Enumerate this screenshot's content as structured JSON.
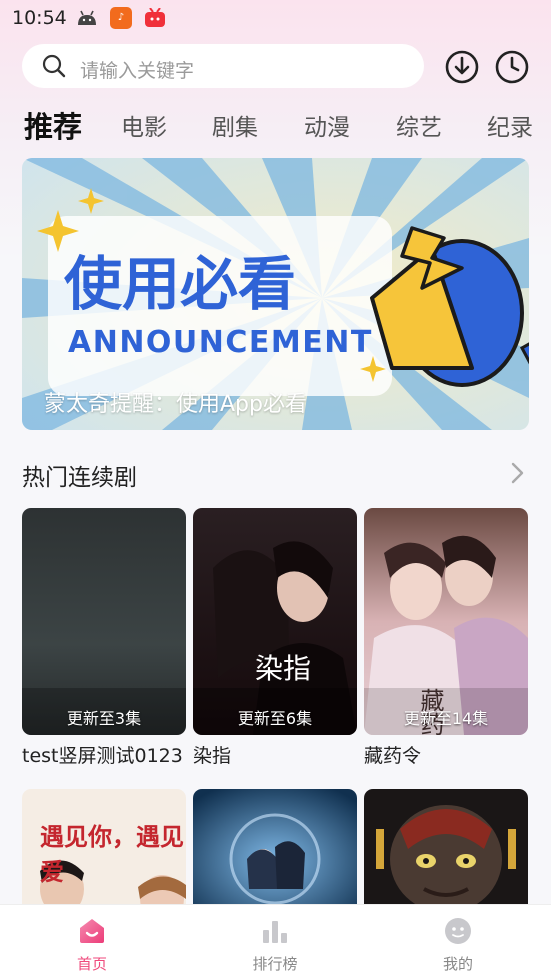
{
  "status_bar": {
    "time": "10:54"
  },
  "search": {
    "placeholder": "请输入关键字"
  },
  "tabs": [
    {
      "label": "推荐",
      "active": true
    },
    {
      "label": "电影"
    },
    {
      "label": "剧集"
    },
    {
      "label": "动漫"
    },
    {
      "label": "综艺"
    },
    {
      "label": "纪录"
    }
  ],
  "banner": {
    "headline": "使用必看",
    "subheadline": "ANNOUNCEMENT",
    "caption": "蒙太奇提醒：使用App必看"
  },
  "section": {
    "title": "热门连续剧"
  },
  "shows": [
    {
      "title": "test竖屏测试0123",
      "badge": "更新至3集"
    },
    {
      "title": "染指",
      "badge": "更新至6集",
      "poster_text": "染指"
    },
    {
      "title": "藏药令",
      "badge": "更新至14集",
      "poster_text": "藏药令"
    }
  ],
  "second_row": [
    {
      "poster_text": "遇见你，遇见爱"
    },
    {
      "poster_text": ""
    },
    {
      "poster_text": ""
    }
  ],
  "bottom_nav": [
    {
      "label": "首页",
      "active": true,
      "icon": "home-icon"
    },
    {
      "label": "排行榜",
      "icon": "ranking-icon"
    },
    {
      "label": "我的",
      "icon": "profile-icon"
    }
  ],
  "colors": {
    "accent": "#ef4a7c",
    "banner_blue": "#2f63d6",
    "banner_yellow": "#f6c53a"
  }
}
